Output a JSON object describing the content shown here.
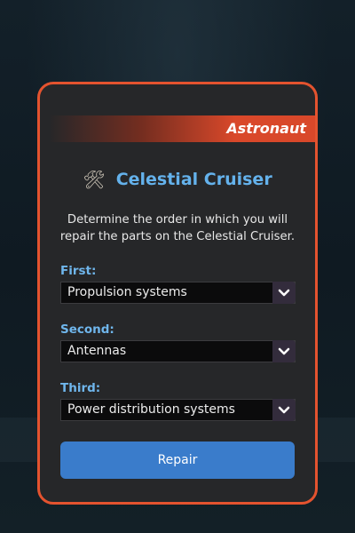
{
  "badge": {
    "label": "Astronaut"
  },
  "header": {
    "icon": "hammer-and-wrench-icon",
    "title": "Celestial Cruiser"
  },
  "description": "Determine the order in which you will repair the parts on the Celestial Cruiser.",
  "fields": [
    {
      "label": "First:",
      "value": "Propulsion systems"
    },
    {
      "label": "Second:",
      "value": "Antennas"
    },
    {
      "label": "Third:",
      "value": "Power distribution systems"
    }
  ],
  "action": {
    "label": "Repair"
  },
  "colors": {
    "accent": "#e4532f",
    "title": "#64b2ec",
    "button": "#3a7ccb",
    "card": "#262729"
  }
}
